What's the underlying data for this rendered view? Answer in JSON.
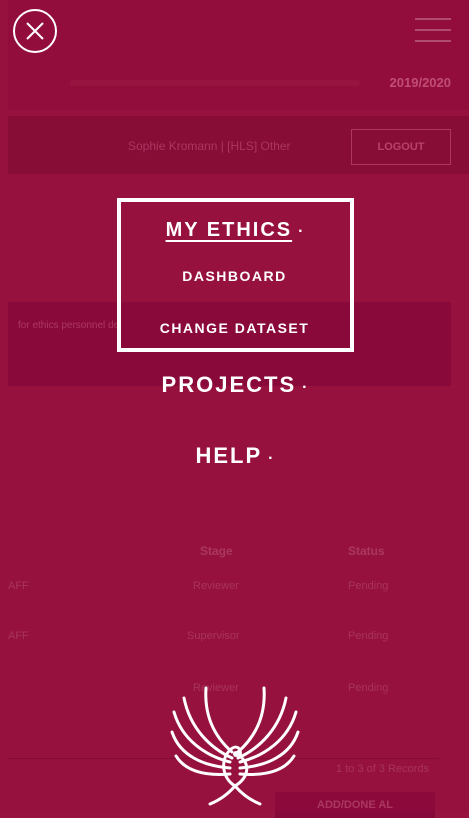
{
  "background": {
    "year": "2019/2020",
    "user": "Sophie Kromann  |  [HLS] Other",
    "logout": "LOGOUT",
    "notice": "for ethics personnel  de",
    "table": {
      "headers": [
        "Stage",
        "Status"
      ],
      "rows": [
        {
          "name": "AFF",
          "stage": "Reviewer",
          "status": "Pending"
        },
        {
          "name": "AFF",
          "stage": "Supervisor",
          "status": "Pending"
        },
        {
          "name": "",
          "stage": "Reviewer",
          "status": "Pending"
        }
      ],
      "records": "1 to 3 of 3 Records",
      "button": "ADD/DONE AL"
    }
  },
  "menu": {
    "my_ethics": "MY ETHICS",
    "dashboard": "DASHBOARD",
    "change_dataset": "CHANGE DATASET",
    "projects": "PROJECTS",
    "help": "HELP",
    "dot": "·"
  },
  "icons": {
    "close": "close-icon",
    "menu": "hamburger-icon",
    "logo": "phoenix-logo"
  },
  "colors": {
    "background": "#96143f",
    "text": "#ffffff",
    "accent": "#8f0e3b"
  }
}
